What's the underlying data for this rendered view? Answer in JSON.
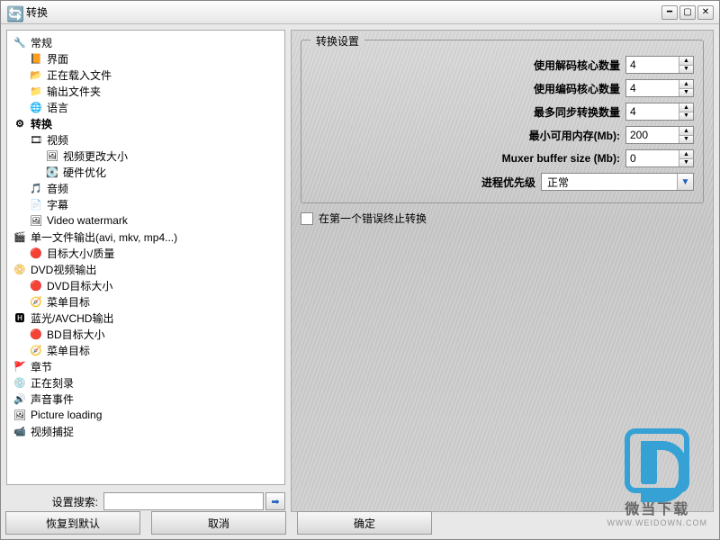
{
  "window": {
    "title": "转换"
  },
  "tree": [
    {
      "label": "常规",
      "icon": "🔧",
      "indent": 0,
      "bold": false
    },
    {
      "label": "界面",
      "icon": "📙",
      "indent": 1,
      "bold": false
    },
    {
      "label": "正在载入文件",
      "icon": "📂",
      "indent": 1,
      "bold": false
    },
    {
      "label": "输出文件夹",
      "icon": "📁",
      "indent": 1,
      "bold": false
    },
    {
      "label": "语言",
      "icon": "🌐",
      "indent": 1,
      "bold": false
    },
    {
      "label": "转换",
      "icon": "⚙",
      "indent": 0,
      "bold": true
    },
    {
      "label": "视频",
      "icon": "🎞",
      "indent": 1,
      "bold": false
    },
    {
      "label": "视频更改大小",
      "icon": "🖼",
      "indent": 2,
      "bold": false
    },
    {
      "label": "硬件优化",
      "icon": "💽",
      "indent": 2,
      "bold": false
    },
    {
      "label": "音频",
      "icon": "🎵",
      "indent": 1,
      "bold": false
    },
    {
      "label": "字幕",
      "icon": "📄",
      "indent": 1,
      "bold": false
    },
    {
      "label": "Video watermark",
      "icon": "🖼",
      "indent": 1,
      "bold": false
    },
    {
      "label": "单一文件输出(avi, mkv, mp4...)",
      "icon": "🎬",
      "indent": 0,
      "bold": false
    },
    {
      "label": "目标大小/质量",
      "icon": "🔴",
      "indent": 1,
      "bold": false
    },
    {
      "label": "DVD视频输出",
      "icon": "📀",
      "indent": 0,
      "bold": false
    },
    {
      "label": "DVD目标大小",
      "icon": "🔴",
      "indent": 1,
      "bold": false
    },
    {
      "label": "菜单目标",
      "icon": "🧭",
      "indent": 1,
      "bold": false
    },
    {
      "label": "蓝光/AVCHD输出",
      "icon": "🅷",
      "indent": 0,
      "bold": false
    },
    {
      "label": "BD目标大小",
      "icon": "🔴",
      "indent": 1,
      "bold": false
    },
    {
      "label": "菜单目标",
      "icon": "🧭",
      "indent": 1,
      "bold": false
    },
    {
      "label": "章节",
      "icon": "🚩",
      "indent": 0,
      "bold": false
    },
    {
      "label": "正在刻录",
      "icon": "💿",
      "indent": 0,
      "bold": false
    },
    {
      "label": "声音事件",
      "icon": "🔊",
      "indent": 0,
      "bold": false
    },
    {
      "label": "Picture loading",
      "icon": "🖼",
      "indent": 0,
      "bold": false
    },
    {
      "label": "视频捕捉",
      "icon": "📹",
      "indent": 0,
      "bold": false
    }
  ],
  "search": {
    "label": "设置搜索:",
    "value": ""
  },
  "buttons": {
    "restore": "恢复到默认",
    "cancel": "取消",
    "ok": "确定"
  },
  "panel": {
    "title": "转换设置",
    "fields": {
      "decode_cores": {
        "label": "使用解码核心数量",
        "value": "4"
      },
      "encode_cores": {
        "label": "使用编码核心数量",
        "value": "4"
      },
      "max_sync": {
        "label": "最多同步转换数量",
        "value": "4"
      },
      "min_mem": {
        "label": "最小可用内存(Mb):",
        "value": "200"
      },
      "muxer": {
        "label": "Muxer buffer size (Mb):",
        "value": "0"
      },
      "priority": {
        "label": "进程优先级",
        "value": "正常"
      }
    },
    "stop_on_error": {
      "label": "在第一个错误终止转换",
      "checked": false
    }
  },
  "watermark": {
    "name": "微当下载",
    "url": "WWW.WEIDOWN.COM"
  }
}
